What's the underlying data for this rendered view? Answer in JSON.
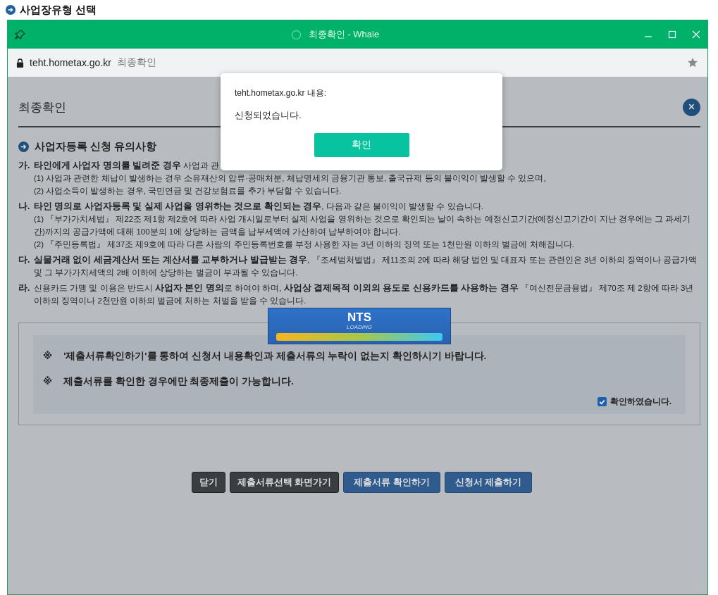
{
  "background_page": {
    "title": "사업장유형 선택"
  },
  "window": {
    "title": "최종확인 - Whale",
    "address": "teht.hometax.go.kr",
    "page_title": "최종확인"
  },
  "page": {
    "heading": "최종확인",
    "close_symbol": "×",
    "section_title": "사업자등록 신청 유의사항",
    "items": [
      {
        "marker": "가.",
        "text": "**타인에게 사업자 명의를 빌려준 경우** 사업과 관",
        "subs": [
          "(1) 사업과 관련한 체납이 발생하는 경우 소유재산의 압류·공매처분, 체납명세의 금융기관 통보, 출국규제 등의 불이익이 발생할 수 있으며,",
          "(2) 사업소득이 발생하는 경우, 국민연금 및 건강보험료를 추가 부담할 수 있습니다."
        ]
      },
      {
        "marker": "나.",
        "text": "**타인 명의로 사업자등록 및 실제 사업을 영위하는 것으로 확인되는 경우**, 다음과 같은 불이익이 발생할 수 있습니다.",
        "subs": [
          "(1) 『부가가치세법』 제22조 제1항 제2호에 따라 사업 개시일로부터 실제 사업을 영위하는 것으로 확인되는 날이 속하는 예정신고기간(예정신고기간이 지난 경우에는 그 과세기간)까지의 공급가액에 대해 100분의 1에 상당하는 금액을 납부세액에 가산하여 납부하여야 합니다.",
          "(2) 『주민등록법』 제37조 제9호에 따라 다른 사람의 주민등록번호를 부정 사용한 자는 3년 이하의 징역 또는 1천만원 이하의 벌금에 처해집니다."
        ]
      },
      {
        "marker": "다.",
        "text": "**실물거래 없이 세금계산서 또는 계산서를 교부하거나 발급받는 경우**, 『조세범처벌법』 제11조의 2에 따라 해당 법인 및 대표자 또는 관련인은 3년 이하의 징역이나 공급가액 및 그 부가가치세액의 2배 이하에 상당하는 벌금이 부과될 수 있습니다."
      },
      {
        "marker": "라.",
        "text": "신용카드 가맹 및 이용은 반드시 **사업자 본인 명의**로 하여야 하며, **사업상 결제목적 이외의 용도로 신용카드를 사용하는 경우** 『여신전문금융법』 제70조 제 2항에 따라 3년이하의 징역이나 2천만원 이하의 벌금에 처하는 처벌을 받을 수 있습니다."
      }
    ],
    "notice": {
      "marker": "※",
      "lines": [
        "'제출서류확인하기'를 통하여 신청서 내용확인과 제출서류의 누락이 없는지 확인하시기 바랍니다.",
        "제출서류를 확인한 경우에만 최종제출이 가능합니다."
      ],
      "checkbox": {
        "label": "확인하였습니다.",
        "checked": true
      }
    },
    "buttons": [
      {
        "label": "닫기",
        "kind": "dark"
      },
      {
        "label": "제출서류선택 화면가기",
        "kind": "dark"
      },
      {
        "label": "제출서류 확인하기",
        "kind": "blue"
      },
      {
        "label": "신청서 제출하기",
        "kind": "blue"
      }
    ]
  },
  "loading": {
    "title": "NTS",
    "subtitle": "LOADING"
  },
  "alert": {
    "origin": "teht.hometax.go.kr 내용:",
    "message": "신청되었습니다.",
    "button": "확인"
  }
}
